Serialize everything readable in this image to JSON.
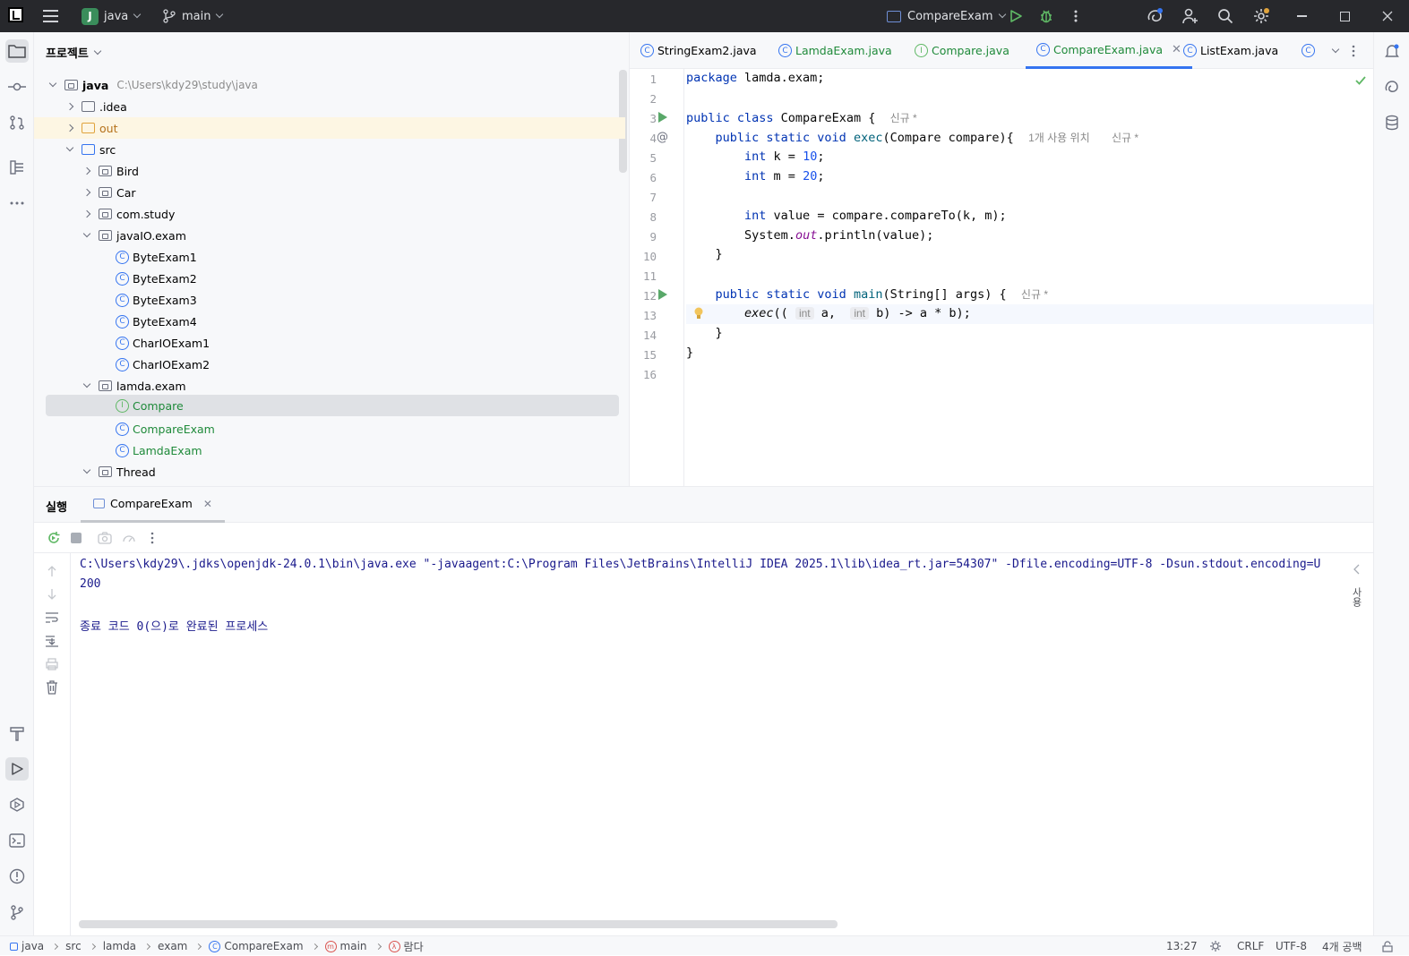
{
  "header": {
    "project_badge": "J",
    "project_name": "java",
    "branch": "main",
    "run_config": "CompareExam"
  },
  "project_panel": {
    "title": "프로젝트",
    "root_name": "java",
    "root_path": "C:\\Users\\kdy29\\study\\java",
    "tree": [
      {
        "label": ".idea"
      },
      {
        "label": "out"
      },
      {
        "label": "src"
      },
      {
        "label": "Bird"
      },
      {
        "label": "Car"
      },
      {
        "label": "com.study"
      },
      {
        "label": "javaIO.exam"
      },
      {
        "label": "ByteExam1"
      },
      {
        "label": "ByteExam2"
      },
      {
        "label": "ByteExam3"
      },
      {
        "label": "ByteExam4"
      },
      {
        "label": "CharIOExam1"
      },
      {
        "label": "CharIOExam2"
      },
      {
        "label": "lamda.exam"
      },
      {
        "label": "Compare"
      },
      {
        "label": "CompareExam"
      },
      {
        "label": "LamdaExam"
      },
      {
        "label": "Thread"
      }
    ]
  },
  "editor": {
    "tabs": [
      {
        "label": "StringExam2.java"
      },
      {
        "label": "LamdaExam.java"
      },
      {
        "label": "Compare.java"
      },
      {
        "label": "CompareExam.java"
      },
      {
        "label": "ListExam.java"
      }
    ],
    "line_numbers": [
      "1",
      "2",
      "3",
      "4",
      "5",
      "6",
      "7",
      "8",
      "9",
      "10",
      "11",
      "12",
      "13",
      "14",
      "15",
      "16"
    ],
    "code": {
      "l1_kw": "package",
      "l1_rest": " lamda.exam;",
      "l3_kw": "public class",
      "l3_name": " CompareExam {",
      "l3_hint": "신규 *",
      "l4_kw": "public static void",
      "l4_fn": "exec",
      "l4_rest": "(Compare compare){",
      "l4_usage": "1개 사용 위치",
      "l4_hint": "신규 *",
      "l5_kw": "int",
      "l5_mid": " k = ",
      "l5_num": "10",
      "l5_end": ";",
      "l6_kw": "int",
      "l6_mid": " m = ",
      "l6_num": "20",
      "l6_end": ";",
      "l8_kw": "int",
      "l8_rest": " value = compare.compareTo(k, m);",
      "l9_a": "System.",
      "l9_out": "out",
      "l9_b": ".println(value);",
      "l10": "}",
      "l12_kw": "public static void",
      "l12_fn": "main",
      "l12_rest": "(String[] args) {",
      "l12_hint": "신규 *",
      "l13_fn": "exec",
      "l13_open": "((",
      "l13_inlay1": "int",
      "l13_a": "a,",
      "l13_inlay2": "int",
      "l13_b": "b) -> a * b);",
      "l14": "}",
      "l15": "}"
    }
  },
  "run_panel": {
    "tab_title": "실행",
    "config_tab": "CompareExam",
    "console": [
      "C:\\Users\\kdy29\\.jdks\\openjdk-24.0.1\\bin\\java.exe \"-javaagent:C:\\Program Files\\JetBrains\\IntelliJ IDEA 2025.1\\lib\\idea_rt.jar=54307\" -Dfile.encoding=UTF-8 -Dsun.stdout.encoding=U",
      "200",
      "",
      "종료 코드 0(으)로 완료된 프로세스"
    ],
    "right_label": "사용"
  },
  "statusbar": {
    "crumbs": [
      "java",
      "src",
      "lamda",
      "exam",
      "CompareExam",
      "main",
      "람다"
    ],
    "position": "13:27",
    "line_sep": "CRLF",
    "encoding": "UTF-8",
    "indent": "4개 공백"
  },
  "colors": {
    "accent": "#3574f0",
    "run_green": "#59a869",
    "topbar": "#27282c"
  }
}
